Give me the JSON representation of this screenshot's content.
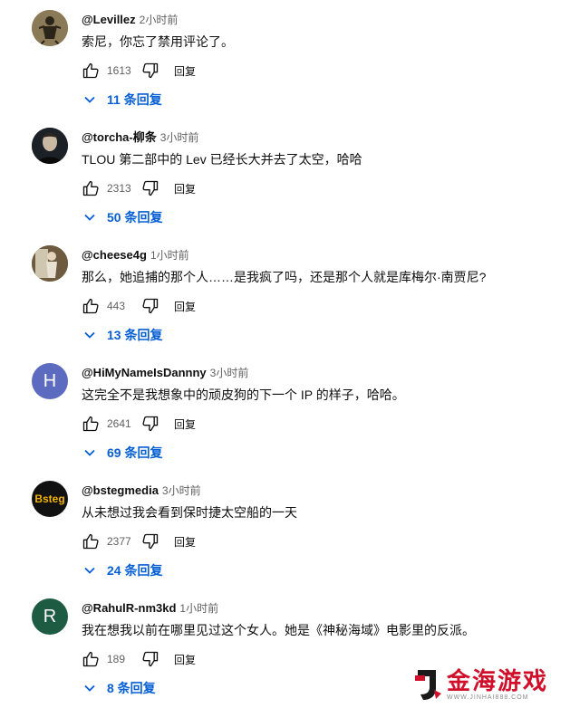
{
  "comments": [
    {
      "author": "@Levillez",
      "time": "2小时前",
      "text": "索尼，你忘了禁用评论了。",
      "likes": "1613",
      "reply_label": "回复",
      "replies_label": "11 条回复",
      "avatar": {
        "kind": "image",
        "icon": "antique-figure-avatar",
        "bg": "#8a7a57"
      }
    },
    {
      "author": "@torcha-柳条",
      "time": "3小时前",
      "text": "TLOU 第二部中的 Lev 已经长大并去了太空，哈哈",
      "likes": "2313",
      "reply_label": "回复",
      "replies_label": "50 条回复",
      "avatar": {
        "kind": "image",
        "icon": "dark-portrait-avatar",
        "bg": "#1c2128"
      }
    },
    {
      "author": "@cheese4g",
      "time": "1小时前",
      "text": "那么，她追捕的那个人……是我疯了吗，还是那个人就是库梅尔·南贾尼?",
      "likes": "443",
      "reply_label": "回复",
      "replies_label": "13 条回复",
      "avatar": {
        "kind": "image",
        "icon": "figure-painting-avatar",
        "bg": "#6e5a3e"
      }
    },
    {
      "author": "@HiMyNameIsDannny",
      "time": "3小时前",
      "text": "这完全不是我想象中的顽皮狗的下一个 IP 的样子，哈哈。",
      "likes": "2641",
      "reply_label": "回复",
      "replies_label": "69 条回复",
      "avatar": {
        "kind": "letter",
        "letter": "H",
        "bg": "#5c6bc0"
      }
    },
    {
      "author": "@bstegmedia",
      "time": "3小时前",
      "text": "从未想过我会看到保时捷太空船的一天",
      "likes": "2377",
      "reply_label": "回复",
      "replies_label": "24 条回复",
      "avatar": {
        "kind": "logo",
        "logo_text": "Bsteg",
        "bg": "#111111",
        "fg": "#f4b400"
      }
    },
    {
      "author": "@RahulR-nm3kd",
      "time": "1小时前",
      "text": "我在想我以前在哪里见过这个女人。她是《神秘海域》电影里的反派。",
      "likes": "189",
      "reply_label": "回复",
      "replies_label": "8 条回复",
      "avatar": {
        "kind": "letter",
        "letter": "R",
        "bg": "#1e5b43"
      }
    }
  ],
  "watermark": {
    "title": "金海游戏",
    "url": "WWW.JINHAI888.COM"
  },
  "colors": {
    "link": "#065fd4",
    "secondary_text": "#606060",
    "watermark_red": "#d0102a"
  }
}
